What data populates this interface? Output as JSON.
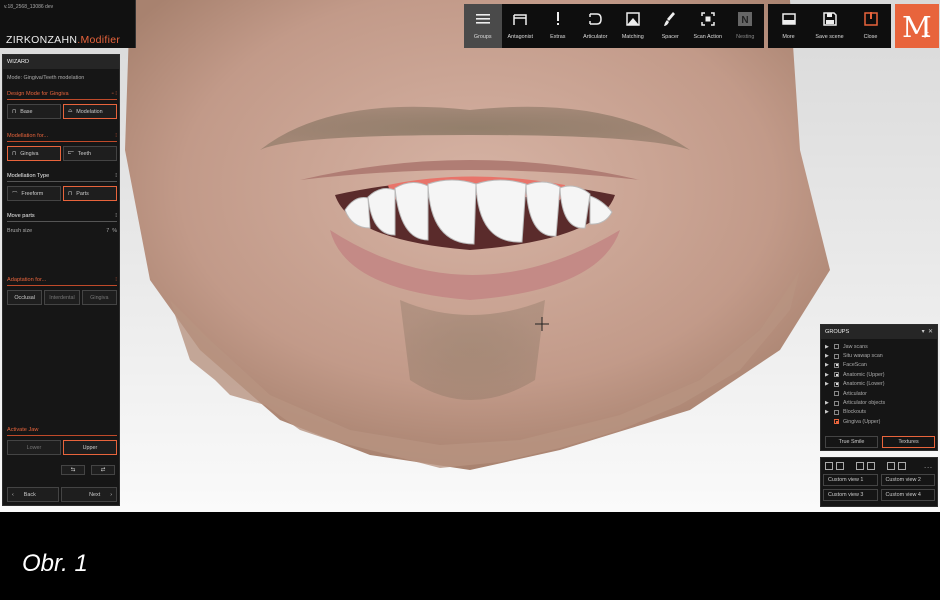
{
  "app": {
    "version": "v.18_2568_13086 dev",
    "brand_main": "ZIRKONZAHN",
    "brand_accent": ".Modifier",
    "logo_letter": "M",
    "logo_sub": "F"
  },
  "toolbar": {
    "groups": "Groups",
    "antagonist": "Antagonist",
    "extras": "Extras",
    "articulator": "Articulator",
    "matching": "Matching",
    "spacer": "Spacer",
    "scan_action": "Scan Action",
    "nesting": "Nesting",
    "more": "More",
    "save_scene": "Save scene",
    "close": "Close"
  },
  "wizard": {
    "title": "WIZARD",
    "mode": "Mode: Gingiva/Teeth modelation",
    "design_mode_head": "Design Mode for Gingiva",
    "base": "Base",
    "modelation": "Modelation",
    "modellation_for_head": "Modellation for...",
    "gingiva": "Gingiva",
    "teeth": "Teeth",
    "modellation_type_head": "Modellation Type",
    "freeform": "Freeform",
    "parts": "Parts",
    "move_parts_head": "Move parts",
    "brush_size_label": "Brush size",
    "brush_size_value": "7",
    "brush_size_unit": "%",
    "adaptation_head": "Adaptation for...",
    "occlusal": "Occlusal",
    "interdental": "Interdental",
    "gingiva2": "Gingiva",
    "activate_jaw_head": "Activate Jaw",
    "lower": "Lower",
    "upper": "Upper",
    "back": "Back",
    "next": "Next"
  },
  "groups": {
    "title": "GROUPS",
    "items": [
      {
        "label": "Jaw scans",
        "arrow": true,
        "state": "off"
      },
      {
        "label": "Situ wawap scan",
        "arrow": true,
        "state": "off"
      },
      {
        "label": "FaceScan",
        "arrow": true,
        "state": "on"
      },
      {
        "label": "Anatomic (Upper)",
        "arrow": true,
        "state": "on"
      },
      {
        "label": "Anatomic (Lower)",
        "arrow": true,
        "state": "on"
      },
      {
        "label": "Articulator",
        "arrow": false,
        "state": "off"
      },
      {
        "label": "Articulator objects",
        "arrow": true,
        "state": "off"
      },
      {
        "label": "Blockouts",
        "arrow": true,
        "state": "off"
      },
      {
        "label": "Gingiva (Upper)",
        "arrow": false,
        "state": "red"
      }
    ],
    "true_smile": "True Smile",
    "textures": "Textures"
  },
  "views": {
    "custom1": "Custom view 1",
    "custom2": "Custom view 2",
    "custom3": "Custom view 3",
    "custom4": "Custom view 4",
    "more": "..."
  },
  "caption": "Obr. 1",
  "colors": {
    "accent": "#e8643c",
    "panel": "#161616",
    "toolbar": "#0e0e0e"
  }
}
